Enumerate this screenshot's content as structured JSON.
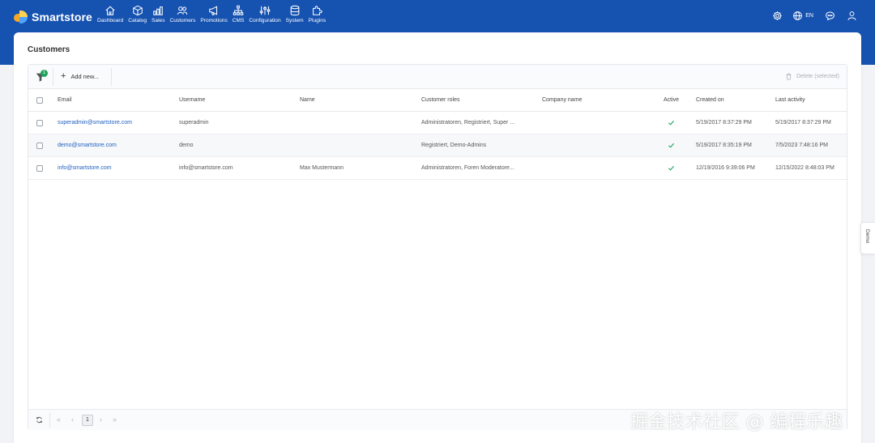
{
  "app": {
    "brand": "Smartstore",
    "colors": {
      "header": "#1652b0",
      "link": "#1e5fbf",
      "success": "#1fa35a"
    }
  },
  "nav": {
    "items": [
      {
        "label": "Dashboard",
        "icon": "home-icon"
      },
      {
        "label": "Catalog",
        "icon": "box-icon"
      },
      {
        "label": "Sales",
        "icon": "chart-icon"
      },
      {
        "label": "Customers",
        "icon": "users-icon"
      },
      {
        "label": "Promotions",
        "icon": "megaphone-icon"
      },
      {
        "label": "CMS",
        "icon": "sitemap-icon"
      },
      {
        "label": "Configuration",
        "icon": "sliders-icon"
      },
      {
        "label": "System",
        "icon": "database-icon"
      },
      {
        "label": "Plugins",
        "icon": "puzzle-icon"
      }
    ]
  },
  "topright": {
    "language": "EN"
  },
  "page": {
    "title": "Customers"
  },
  "toolbar": {
    "filter_count": "1",
    "add_new": "Add new...",
    "delete_selected": "Delete (selected)"
  },
  "table": {
    "headers": {
      "email": "Email",
      "username": "Username",
      "name": "Name",
      "roles": "Customer roles",
      "company": "Company name",
      "active": "Active",
      "created": "Created on",
      "last": "Last activity"
    },
    "rows": [
      {
        "email": "superadmin@smartstore.com",
        "username": "superadmin",
        "name": "",
        "roles": "Administratoren, Registriert, Super ...",
        "company": "",
        "active": true,
        "created": "5/19/2017 8:37:29 PM",
        "last": "5/19/2017 8:37:29 PM"
      },
      {
        "email": "demo@smartstore.com",
        "username": "demo",
        "name": "",
        "roles": "Registriert, Demo-Admins",
        "company": "",
        "active": true,
        "created": "5/19/2017 8:35:19 PM",
        "last": "7/5/2023 7:48:16 PM"
      },
      {
        "email": "info@smartstore.com",
        "username": "info@smartstore.com",
        "name": "Max Mustermann",
        "roles": "Administratoren, Foren Moderatore...",
        "company": "",
        "active": true,
        "created": "12/19/2016 9:39:06 PM",
        "last": "12/15/2022 8:48:03 PM"
      }
    ]
  },
  "pager": {
    "current_page": "1"
  },
  "side_tab": {
    "label": "Demo"
  },
  "watermark": {
    "text": "掘金技术社区 @ 编程乐趣"
  }
}
